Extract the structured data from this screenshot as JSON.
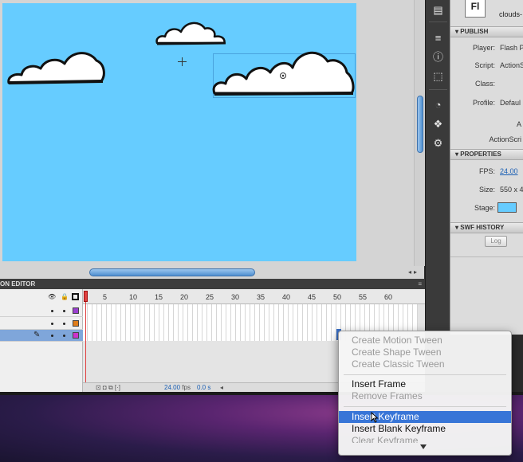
{
  "document": {
    "icon_label": "Fl",
    "name": "clouds-"
  },
  "publish": {
    "header": "PUBLISH",
    "player_label": "Player:",
    "player_value": "Flash P",
    "script_label": "Script:",
    "script_value": "ActionS",
    "class_label": "Class:",
    "profile_label": "Profile:",
    "profile_value": "Defaul",
    "a_label": "A",
    "actionscript_label": "ActionScri"
  },
  "properties": {
    "header": "PROPERTIES",
    "fps_label": "FPS:",
    "fps_value": "24.00",
    "size_label": "Size:",
    "size_value": "550 x 4",
    "stage_label": "Stage:",
    "stage_color": "#66ccff"
  },
  "swf_history": {
    "header": "SWF HISTORY",
    "log_button": "Log"
  },
  "timeline": {
    "header_label": "ON EDITOR",
    "ruler_numbers": [
      "5",
      "10",
      "15",
      "20",
      "25",
      "30",
      "35",
      "40",
      "45",
      "50",
      "55",
      "60"
    ],
    "layer_colors": [
      "#9b3fd0",
      "#e07d1a",
      "#cc33cc"
    ],
    "status_fps": "24.00",
    "status_fps_unit": "fps",
    "status_time": "0.0 s"
  },
  "context_menu": {
    "items": [
      {
        "label": "Create Motion Tween",
        "disabled": true
      },
      {
        "label": "Create Shape Tween",
        "disabled": true
      },
      {
        "label": "Create Classic Tween",
        "disabled": true
      },
      {
        "label": "Insert Frame",
        "disabled": false
      },
      {
        "label": "Remove Frames",
        "disabled": true
      },
      {
        "label": "Insert Keyframe",
        "disabled": false,
        "active": true
      },
      {
        "label": "Insert Blank Keyframe",
        "disabled": false
      },
      {
        "label": "Clear Keyframe",
        "disabled": true
      }
    ]
  },
  "colors": {
    "stage": "#66ccff",
    "menu_highlight": "#3875d7",
    "playhead": "#e04040"
  }
}
